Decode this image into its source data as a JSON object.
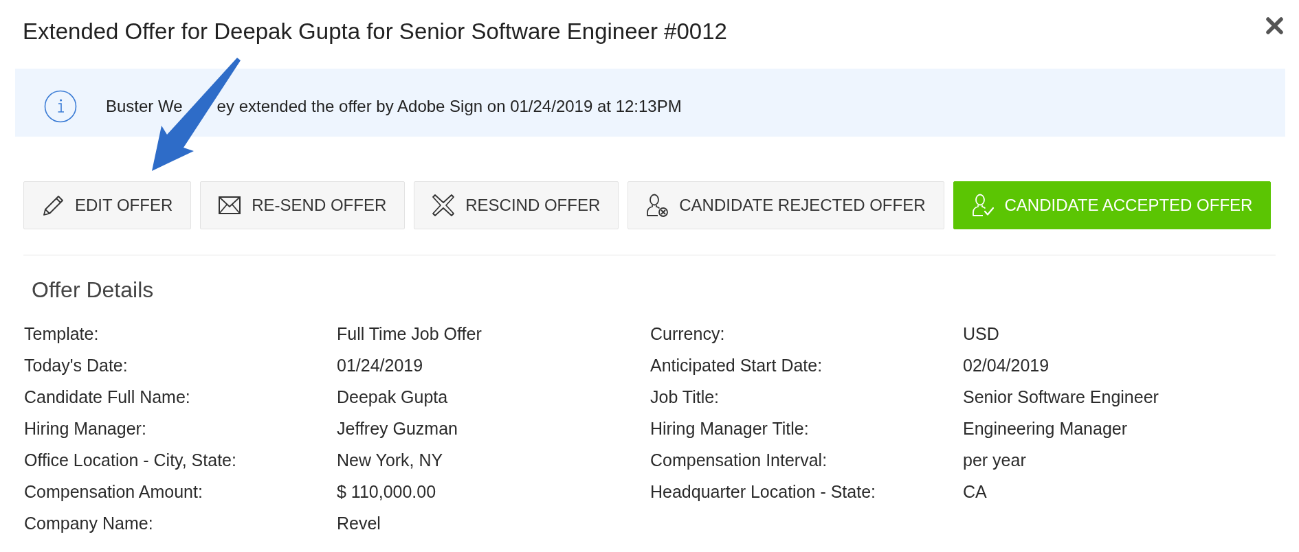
{
  "dialog": {
    "title": "Extended Offer for Deepak Gupta for Senior Software Engineer #0012"
  },
  "notice": {
    "message_fragments": [
      "Buster We",
      "ey extended the offer by Adobe Sign on 01/24/2019 at 12:13PM"
    ]
  },
  "actions": [
    {
      "label": "EDIT OFFER",
      "kind": "default"
    },
    {
      "label": "RE-SEND OFFER",
      "kind": "default"
    },
    {
      "label": "RESCIND OFFER",
      "kind": "default"
    },
    {
      "label": "CANDIDATE REJECTED OFFER",
      "kind": "default"
    },
    {
      "label": "CANDIDATE ACCEPTED OFFER",
      "kind": "primary"
    }
  ],
  "offer_details": {
    "title": "Offer Details",
    "left": [
      {
        "label": "Template:",
        "value": "Full Time Job Offer"
      },
      {
        "label": "Today's Date:",
        "value": "01/24/2019"
      },
      {
        "label": "Candidate Full Name:",
        "value": "Deepak Gupta"
      },
      {
        "label": "Hiring Manager:",
        "value": "Jeffrey Guzman"
      },
      {
        "label": "Office Location - City, State:",
        "value": "New York, NY"
      },
      {
        "label": "Compensation Amount:",
        "value": "$ 110,000.00"
      },
      {
        "label": "Company Name:",
        "value": "Revel"
      }
    ],
    "right": [
      {
        "label": "Currency:",
        "value": "USD"
      },
      {
        "label": "Anticipated Start Date:",
        "value": "02/04/2019"
      },
      {
        "label": "Job Title:",
        "value": "Senior Software Engineer"
      },
      {
        "label": "Hiring Manager Title:",
        "value": "Engineering Manager"
      },
      {
        "label": "Compensation Interval:",
        "value": "per year"
      },
      {
        "label": "Headquarter Location - State:",
        "value": "CA"
      }
    ]
  }
}
